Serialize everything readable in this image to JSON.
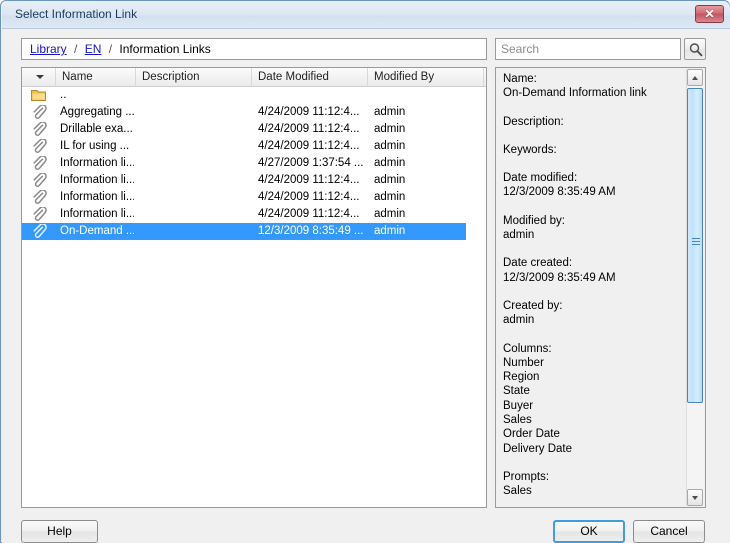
{
  "window": {
    "title": "Select Information Link",
    "close_label": "✕"
  },
  "breadcrumb": {
    "items": [
      {
        "label": "Library",
        "link": true
      },
      {
        "label": "EN",
        "link": true
      },
      {
        "label": "Information Links",
        "link": false
      }
    ],
    "separator": "/"
  },
  "search": {
    "placeholder": "Search",
    "value": "",
    "icon": "search-icon"
  },
  "list": {
    "columns": [
      {
        "label": "",
        "key": "sort"
      },
      {
        "label": "Name",
        "key": "name"
      },
      {
        "label": "Description",
        "key": "description"
      },
      {
        "label": "Date Modified",
        "key": "date_modified"
      },
      {
        "label": "Modified By",
        "key": "modified_by"
      }
    ],
    "sort_indicator": "sort-descending-icon",
    "rows": [
      {
        "icon": "folder-icon",
        "name": "..",
        "description": "",
        "date_modified": "",
        "modified_by": "",
        "selected": false
      },
      {
        "icon": "paperclip-icon",
        "name": "Aggregating ...",
        "description": "",
        "date_modified": "4/24/2009 11:12:4...",
        "modified_by": "admin",
        "selected": false
      },
      {
        "icon": "paperclip-icon",
        "name": "Drillable exa...",
        "description": "",
        "date_modified": "4/24/2009 11:12:4...",
        "modified_by": "admin",
        "selected": false
      },
      {
        "icon": "paperclip-icon",
        "name": "IL for using ...",
        "description": "",
        "date_modified": "4/24/2009 11:12:4...",
        "modified_by": "admin",
        "selected": false
      },
      {
        "icon": "paperclip-icon",
        "name": "Information li...",
        "description": "",
        "date_modified": "4/27/2009 1:37:54 ...",
        "modified_by": "admin",
        "selected": false
      },
      {
        "icon": "paperclip-icon",
        "name": "Information li...",
        "description": "",
        "date_modified": "4/24/2009 11:12:4...",
        "modified_by": "admin",
        "selected": false
      },
      {
        "icon": "paperclip-icon",
        "name": "Information li...",
        "description": "",
        "date_modified": "4/24/2009 11:12:4...",
        "modified_by": "admin",
        "selected": false
      },
      {
        "icon": "paperclip-icon",
        "name": "Information li...",
        "description": "",
        "date_modified": "4/24/2009 11:12:4...",
        "modified_by": "admin",
        "selected": false
      },
      {
        "icon": "paperclip-icon",
        "name": "On-Demand ...",
        "description": "",
        "date_modified": "12/3/2009 8:35:49 ...",
        "modified_by": "admin",
        "selected": true
      }
    ]
  },
  "details": {
    "fields": [
      {
        "label": "Name:",
        "values": [
          "On-Demand Information link"
        ]
      },
      {
        "label": "Description:",
        "values": []
      },
      {
        "label": "Keywords:",
        "values": []
      },
      {
        "label": "Date modified:",
        "values": [
          "12/3/2009 8:35:49 AM"
        ]
      },
      {
        "label": "Modified by:",
        "values": [
          "admin"
        ]
      },
      {
        "label": "Date created:",
        "values": [
          "12/3/2009 8:35:49 AM"
        ]
      },
      {
        "label": "Created by:",
        "values": [
          "admin"
        ]
      },
      {
        "label": "Columns:",
        "values": [
          "Number",
          "Region",
          "State",
          "Buyer",
          "Sales",
          "Order Date",
          "Delivery Date"
        ]
      },
      {
        "label": "Prompts:",
        "values": [
          "Sales"
        ]
      }
    ]
  },
  "buttons": {
    "help": "Help",
    "ok": "OK",
    "cancel": "Cancel"
  },
  "colors": {
    "selection": "#3399ff",
    "link": "#1414cf",
    "title_text": "#1b3a5c",
    "focus_ring": "#3c9ede",
    "close_button": "#c2545f"
  }
}
